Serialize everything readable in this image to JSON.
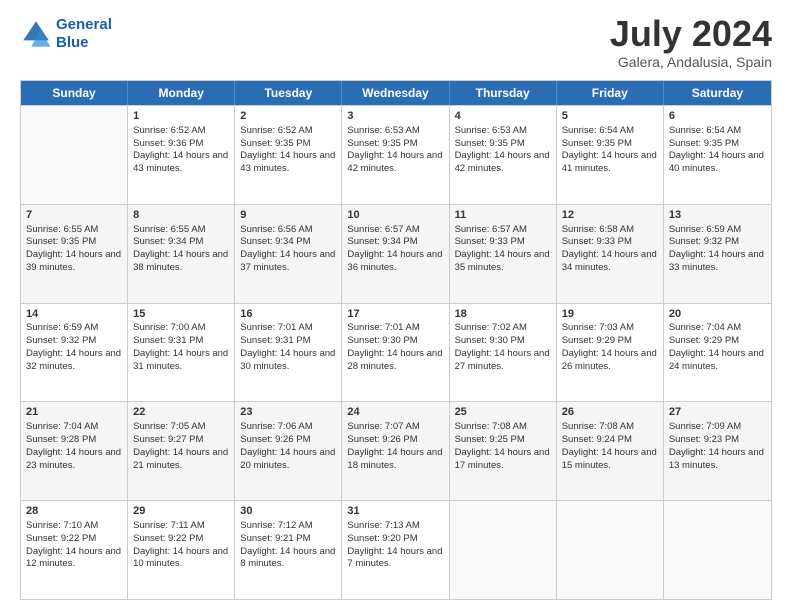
{
  "logo": {
    "line1": "General",
    "line2": "Blue"
  },
  "title": "July 2024",
  "subtitle": "Galera, Andalusia, Spain",
  "weekdays": [
    "Sunday",
    "Monday",
    "Tuesday",
    "Wednesday",
    "Thursday",
    "Friday",
    "Saturday"
  ],
  "weeks": [
    [
      {
        "day": "",
        "sunrise": "",
        "sunset": "",
        "daylight": ""
      },
      {
        "day": "1",
        "sunrise": "Sunrise: 6:52 AM",
        "sunset": "Sunset: 9:36 PM",
        "daylight": "Daylight: 14 hours and 43 minutes."
      },
      {
        "day": "2",
        "sunrise": "Sunrise: 6:52 AM",
        "sunset": "Sunset: 9:35 PM",
        "daylight": "Daylight: 14 hours and 43 minutes."
      },
      {
        "day": "3",
        "sunrise": "Sunrise: 6:53 AM",
        "sunset": "Sunset: 9:35 PM",
        "daylight": "Daylight: 14 hours and 42 minutes."
      },
      {
        "day": "4",
        "sunrise": "Sunrise: 6:53 AM",
        "sunset": "Sunset: 9:35 PM",
        "daylight": "Daylight: 14 hours and 42 minutes."
      },
      {
        "day": "5",
        "sunrise": "Sunrise: 6:54 AM",
        "sunset": "Sunset: 9:35 PM",
        "daylight": "Daylight: 14 hours and 41 minutes."
      },
      {
        "day": "6",
        "sunrise": "Sunrise: 6:54 AM",
        "sunset": "Sunset: 9:35 PM",
        "daylight": "Daylight: 14 hours and 40 minutes."
      }
    ],
    [
      {
        "day": "7",
        "sunrise": "Sunrise: 6:55 AM",
        "sunset": "Sunset: 9:35 PM",
        "daylight": "Daylight: 14 hours and 39 minutes."
      },
      {
        "day": "8",
        "sunrise": "Sunrise: 6:55 AM",
        "sunset": "Sunset: 9:34 PM",
        "daylight": "Daylight: 14 hours and 38 minutes."
      },
      {
        "day": "9",
        "sunrise": "Sunrise: 6:56 AM",
        "sunset": "Sunset: 9:34 PM",
        "daylight": "Daylight: 14 hours and 37 minutes."
      },
      {
        "day": "10",
        "sunrise": "Sunrise: 6:57 AM",
        "sunset": "Sunset: 9:34 PM",
        "daylight": "Daylight: 14 hours and 36 minutes."
      },
      {
        "day": "11",
        "sunrise": "Sunrise: 6:57 AM",
        "sunset": "Sunset: 9:33 PM",
        "daylight": "Daylight: 14 hours and 35 minutes."
      },
      {
        "day": "12",
        "sunrise": "Sunrise: 6:58 AM",
        "sunset": "Sunset: 9:33 PM",
        "daylight": "Daylight: 14 hours and 34 minutes."
      },
      {
        "day": "13",
        "sunrise": "Sunrise: 6:59 AM",
        "sunset": "Sunset: 9:32 PM",
        "daylight": "Daylight: 14 hours and 33 minutes."
      }
    ],
    [
      {
        "day": "14",
        "sunrise": "Sunrise: 6:59 AM",
        "sunset": "Sunset: 9:32 PM",
        "daylight": "Daylight: 14 hours and 32 minutes."
      },
      {
        "day": "15",
        "sunrise": "Sunrise: 7:00 AM",
        "sunset": "Sunset: 9:31 PM",
        "daylight": "Daylight: 14 hours and 31 minutes."
      },
      {
        "day": "16",
        "sunrise": "Sunrise: 7:01 AM",
        "sunset": "Sunset: 9:31 PM",
        "daylight": "Daylight: 14 hours and 30 minutes."
      },
      {
        "day": "17",
        "sunrise": "Sunrise: 7:01 AM",
        "sunset": "Sunset: 9:30 PM",
        "daylight": "Daylight: 14 hours and 28 minutes."
      },
      {
        "day": "18",
        "sunrise": "Sunrise: 7:02 AM",
        "sunset": "Sunset: 9:30 PM",
        "daylight": "Daylight: 14 hours and 27 minutes."
      },
      {
        "day": "19",
        "sunrise": "Sunrise: 7:03 AM",
        "sunset": "Sunset: 9:29 PM",
        "daylight": "Daylight: 14 hours and 26 minutes."
      },
      {
        "day": "20",
        "sunrise": "Sunrise: 7:04 AM",
        "sunset": "Sunset: 9:29 PM",
        "daylight": "Daylight: 14 hours and 24 minutes."
      }
    ],
    [
      {
        "day": "21",
        "sunrise": "Sunrise: 7:04 AM",
        "sunset": "Sunset: 9:28 PM",
        "daylight": "Daylight: 14 hours and 23 minutes."
      },
      {
        "day": "22",
        "sunrise": "Sunrise: 7:05 AM",
        "sunset": "Sunset: 9:27 PM",
        "daylight": "Daylight: 14 hours and 21 minutes."
      },
      {
        "day": "23",
        "sunrise": "Sunrise: 7:06 AM",
        "sunset": "Sunset: 9:26 PM",
        "daylight": "Daylight: 14 hours and 20 minutes."
      },
      {
        "day": "24",
        "sunrise": "Sunrise: 7:07 AM",
        "sunset": "Sunset: 9:26 PM",
        "daylight": "Daylight: 14 hours and 18 minutes."
      },
      {
        "day": "25",
        "sunrise": "Sunrise: 7:08 AM",
        "sunset": "Sunset: 9:25 PM",
        "daylight": "Daylight: 14 hours and 17 minutes."
      },
      {
        "day": "26",
        "sunrise": "Sunrise: 7:08 AM",
        "sunset": "Sunset: 9:24 PM",
        "daylight": "Daylight: 14 hours and 15 minutes."
      },
      {
        "day": "27",
        "sunrise": "Sunrise: 7:09 AM",
        "sunset": "Sunset: 9:23 PM",
        "daylight": "Daylight: 14 hours and 13 minutes."
      }
    ],
    [
      {
        "day": "28",
        "sunrise": "Sunrise: 7:10 AM",
        "sunset": "Sunset: 9:22 PM",
        "daylight": "Daylight: 14 hours and 12 minutes."
      },
      {
        "day": "29",
        "sunrise": "Sunrise: 7:11 AM",
        "sunset": "Sunset: 9:22 PM",
        "daylight": "Daylight: 14 hours and 10 minutes."
      },
      {
        "day": "30",
        "sunrise": "Sunrise: 7:12 AM",
        "sunset": "Sunset: 9:21 PM",
        "daylight": "Daylight: 14 hours and 8 minutes."
      },
      {
        "day": "31",
        "sunrise": "Sunrise: 7:13 AM",
        "sunset": "Sunset: 9:20 PM",
        "daylight": "Daylight: 14 hours and 7 minutes."
      },
      {
        "day": "",
        "sunrise": "",
        "sunset": "",
        "daylight": ""
      },
      {
        "day": "",
        "sunrise": "",
        "sunset": "",
        "daylight": ""
      },
      {
        "day": "",
        "sunrise": "",
        "sunset": "",
        "daylight": ""
      }
    ]
  ]
}
